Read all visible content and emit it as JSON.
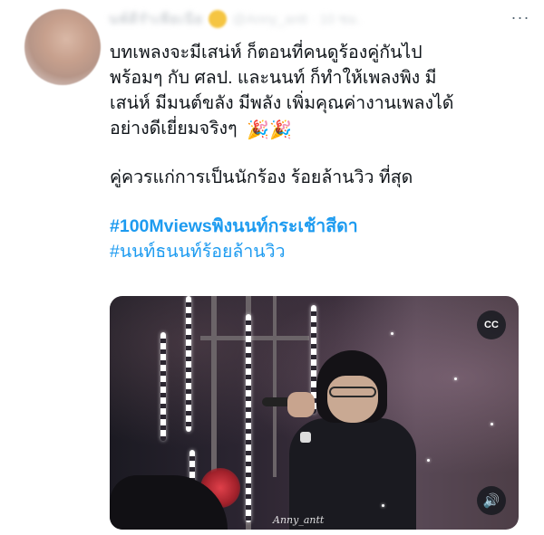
{
  "tweet": {
    "author_name": "นพ์ดีรำเพียเนีย",
    "author_handle": "@Anny_antt · 10 ชม.",
    "lines": [
      "บทเพลงจะมีเสน่ห์ ก็ตอนที่คนดูร้องคู่กันไป",
      "พร้อมๆ กับ ศลป.  และนนท์ ก็ทำให้เพลงพิง  มี",
      "เสน่ห์ มีมนต์ขลัง มีพลัง เพิ่มคุณค่างานเพลงได้",
      "อย่างดีเยี่ยมจริงๆ",
      "คู่ควรแก่การเป็นนักร้อง ร้อยล้านวิว ที่สุด"
    ],
    "party_emoji": "🎉",
    "hashtags": [
      "#100Mviewsพิงนนท์กระเช้าสีดา",
      "#นนท์ธนนท์ร้อยล้านวิว"
    ],
    "more_glyph": "···",
    "media": {
      "caption_glyph": "CC",
      "sound_glyph": "🔊",
      "watermark": "Anny_antt"
    }
  },
  "colors": {
    "text": "#0f1419",
    "link": "#1d9bf0",
    "secondary": "#536471"
  }
}
